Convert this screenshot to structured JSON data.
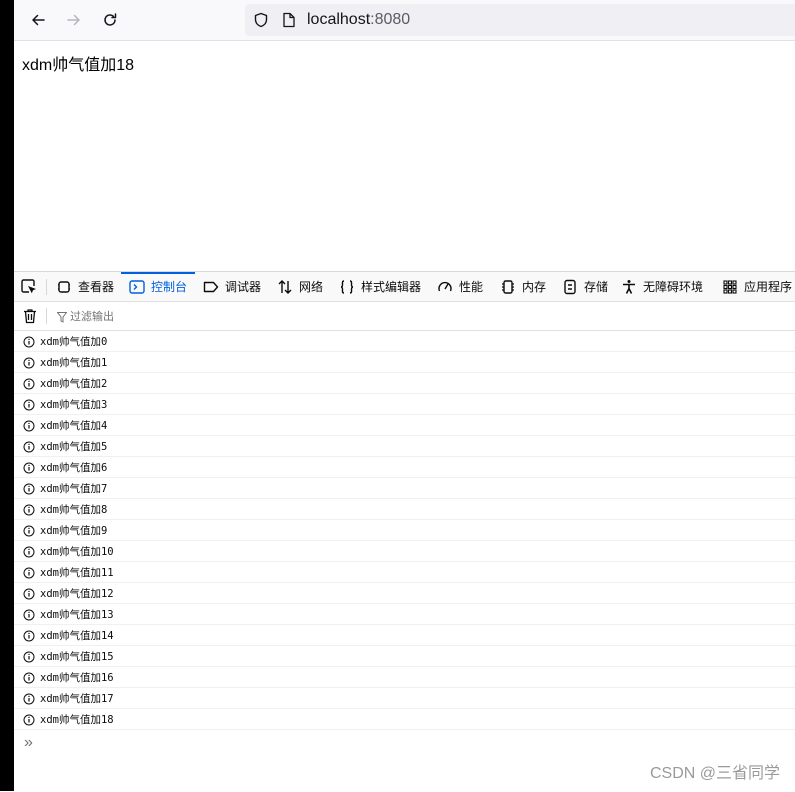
{
  "browser": {
    "back_icon": "arrow-left-icon",
    "forward_icon": "arrow-right-icon",
    "reload_icon": "reload-icon",
    "shield_icon": "shield-icon",
    "page_icon": "page-icon",
    "url_host": "localhost",
    "url_port": ":8080"
  },
  "page": {
    "text": "xdm帅气值加18"
  },
  "devtools": {
    "tabs": [
      {
        "label": "查看器",
        "icon": "inspector-icon"
      },
      {
        "label": "控制台",
        "icon": "console-icon",
        "selected": true
      },
      {
        "label": "调试器",
        "icon": "debugger-icon"
      },
      {
        "label": "网络",
        "icon": "network-icon"
      },
      {
        "label": "样式编辑器",
        "icon": "style-editor-icon"
      },
      {
        "label": "性能",
        "icon": "performance-icon"
      },
      {
        "label": "内存",
        "icon": "memory-icon"
      },
      {
        "label": "存储",
        "icon": "storage-icon"
      },
      {
        "label": "无障碍环境",
        "icon": "accessibility-icon"
      },
      {
        "label": "应用程序",
        "icon": "application-icon"
      }
    ],
    "filter_placeholder": "过滤输出",
    "messages": [
      "xdm帅气值加0",
      "xdm帅气值加1",
      "xdm帅气值加2",
      "xdm帅气值加3",
      "xdm帅气值加4",
      "xdm帅气值加5",
      "xdm帅气值加6",
      "xdm帅气值加7",
      "xdm帅气值加8",
      "xdm帅气值加9",
      "xdm帅气值加10",
      "xdm帅气值加11",
      "xdm帅气值加12",
      "xdm帅气值加13",
      "xdm帅气值加14",
      "xdm帅气值加15",
      "xdm帅气值加16",
      "xdm帅气值加17",
      "xdm帅气值加18"
    ],
    "prompt_symbol": "»"
  },
  "watermark": "CSDN @三省同学",
  "colors": {
    "accent": "#0060df",
    "toolbar_bg": "#f9f9fb",
    "urlbar_bg": "#f0f0f4"
  }
}
